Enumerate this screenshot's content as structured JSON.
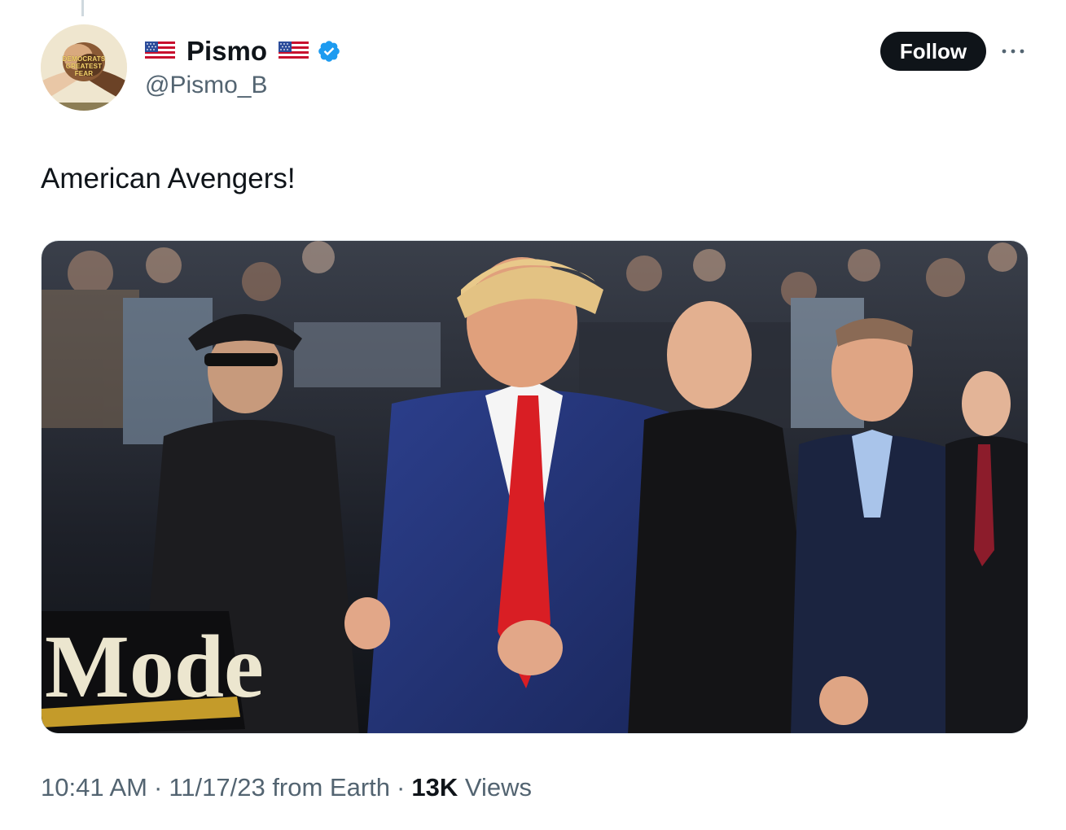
{
  "author": {
    "display_name": "Pismo",
    "handle": "@Pismo_B",
    "verified": true,
    "flag_icon": "us-flag-icon",
    "avatar_text": "DEMOCRATS\nGREATEST\nFEAR"
  },
  "actions": {
    "follow_label": "Follow",
    "more_icon": "more-horizontal-icon"
  },
  "tweet": {
    "text": "American Avengers!",
    "media_text": "Mode"
  },
  "meta": {
    "time": "10:41 AM",
    "date": "11/17/23",
    "source": "from Earth",
    "separator": "·",
    "views_count": "13K",
    "views_label": "Views"
  },
  "colors": {
    "text_primary": "#0f1419",
    "text_secondary": "#536471",
    "verified_blue": "#1d9bf0",
    "follow_bg": "#0f1419"
  }
}
